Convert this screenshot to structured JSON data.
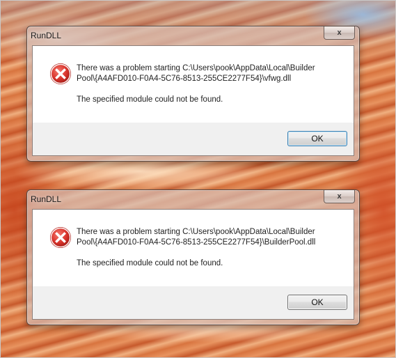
{
  "dialogs": [
    {
      "title": "RunDLL",
      "close_label": "x",
      "icon": "error-icon",
      "message_line_1": "There was a problem starting C:\\Users\\pook\\AppData\\Local\\Builder",
      "message_line_2": "Pool\\{A4AFD010-F0A4-5C76-8513-255CE2277F54}\\vfwg.dll",
      "detail": "The specified module could not be found.",
      "ok_label": "OK"
    },
    {
      "title": "RunDLL",
      "close_label": "x",
      "icon": "error-icon",
      "message_line_1": "There was a problem starting C:\\Users\\pook\\AppData\\Local\\Builder",
      "message_line_2": "Pool\\{A4AFD010-F0A4-5C76-8513-255CE2277F54}\\BuilderPool.dll",
      "detail": "The specified module could not be found.",
      "ok_label": "OK"
    }
  ],
  "colors": {
    "error_red": "#d9342c",
    "dialog_frame": "#5a4a44",
    "button_area": "#f0f0f0"
  }
}
